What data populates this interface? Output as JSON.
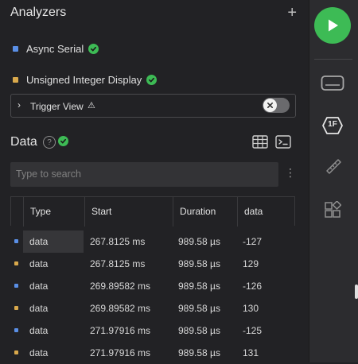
{
  "analyzers": {
    "title": "Analyzers",
    "add_label": "+",
    "items": [
      {
        "label": "Async Serial",
        "color": "#5a8fe6"
      },
      {
        "label": "Unsigned Integer Display",
        "color": "#d9a94c"
      }
    ]
  },
  "trigger": {
    "label": "Trigger View",
    "warning_symbol": "⚠",
    "chevron": "›"
  },
  "data_section": {
    "title": "Data",
    "help_symbol": "?",
    "search_placeholder": "Type to search",
    "kebab": "⋮"
  },
  "table": {
    "columns": [
      "Type",
      "Start",
      "Duration",
      "data"
    ],
    "rows": [
      {
        "marker_color": "#5a8fe6",
        "type": "data",
        "start": "267.8125 ms",
        "duration": "989.58 µs",
        "data": "-127"
      },
      {
        "marker_color": "#d9a94c",
        "type": "data",
        "start": "267.8125 ms",
        "duration": "989.58 µs",
        "data": "129"
      },
      {
        "marker_color": "#5a8fe6",
        "type": "data",
        "start": "269.89582 ms",
        "duration": "989.58 µs",
        "data": "-126"
      },
      {
        "marker_color": "#d9a94c",
        "type": "data",
        "start": "269.89582 ms",
        "duration": "989.58 µs",
        "data": "130"
      },
      {
        "marker_color": "#5a8fe6",
        "type": "data",
        "start": "271.97916 ms",
        "duration": "989.58 µs",
        "data": "-125"
      },
      {
        "marker_color": "#d9a94c",
        "type": "data",
        "start": "271.97916 ms",
        "duration": "989.58 µs",
        "data": "131"
      }
    ]
  },
  "rail": {
    "play_color": "#3dbb55",
    "timing_badge": "1F"
  },
  "colors": {
    "accent_green": "#3dbb55",
    "panel_bg": "#222225",
    "rail_bg": "#2c2c2f"
  }
}
